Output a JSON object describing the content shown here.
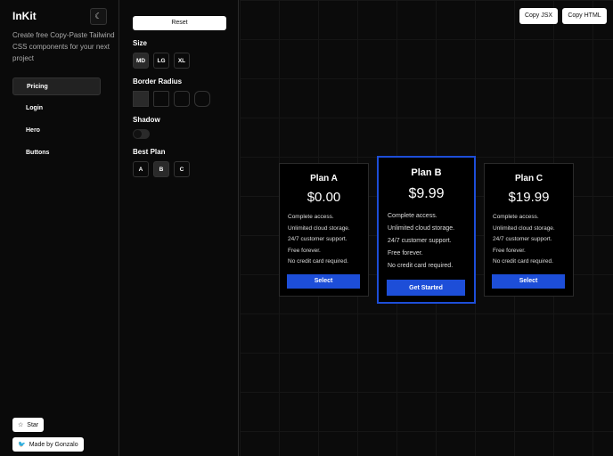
{
  "sidebar": {
    "logo": "InKit",
    "tagline": "Create free Copy-Paste Tailwind CSS components for your next project",
    "nav": [
      "Pricing",
      "Login",
      "Hero",
      "Buttons"
    ],
    "star": "Star",
    "made_by": "Made by Gonzalo"
  },
  "controls": {
    "reset": "Reset",
    "size_label": "Size",
    "sizes": [
      "MD",
      "LG",
      "XL"
    ],
    "radius_label": "Border Radius",
    "shadow_label": "Shadow",
    "shadow_on": false,
    "best_label": "Best Plan",
    "plans": [
      "A",
      "B",
      "C"
    ]
  },
  "toolbar": {
    "copy_jsx": "Copy JSX",
    "copy_html": "Copy HTML"
  },
  "colors": {
    "accent": "#1d4ed8"
  },
  "cards": [
    {
      "title": "Plan A",
      "price": "$0.00",
      "features": [
        "Complete access.",
        "Unlimited cloud storage.",
        "24/7 customer support.",
        "Free forever.",
        "No credit card required."
      ],
      "button": "Select"
    },
    {
      "title": "Plan B",
      "price": "$9.99",
      "features": [
        "Complete access.",
        "Unlimited cloud storage.",
        "24/7 customer support.",
        "Free forever.",
        "No credit card required."
      ],
      "button": "Get Started"
    },
    {
      "title": "Plan C",
      "price": "$19.99",
      "features": [
        "Complete access.",
        "Unlimited cloud storage.",
        "24/7 customer support.",
        "Free forever.",
        "No credit card required."
      ],
      "button": "Select"
    }
  ]
}
